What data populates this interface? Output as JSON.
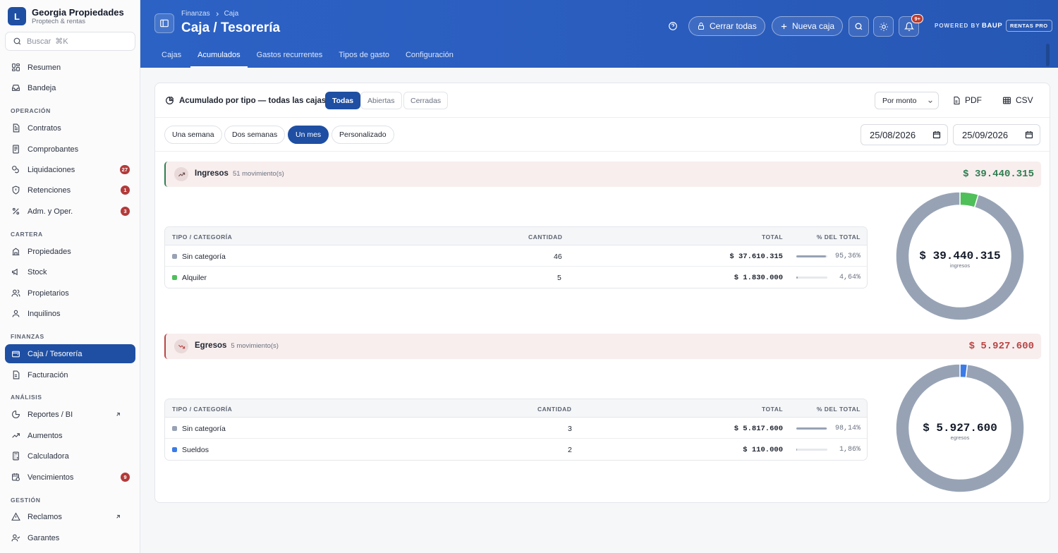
{
  "brand": {
    "initial": "L",
    "name": "Georgia Propiedades",
    "subtitle": "Proptech & rentas"
  },
  "search": {
    "placeholder": "Buscar",
    "shortcut": "⌘K"
  },
  "sidebar": {
    "top": [
      {
        "label": "Resumen",
        "icon": "grid-icon"
      },
      {
        "label": "Bandeja",
        "icon": "inbox-icon"
      }
    ],
    "sections": [
      {
        "label": "OPERACIÓN",
        "items": [
          {
            "label": "Contratos",
            "icon": "document-icon"
          },
          {
            "label": "Comprobantes",
            "icon": "receipt-icon"
          },
          {
            "label": "Liquidaciones",
            "icon": "coins-icon",
            "badge": "27"
          },
          {
            "label": "Retenciones",
            "icon": "shield-icon",
            "badge": "1"
          },
          {
            "label": "Adm. y Oper.",
            "icon": "percent-icon",
            "badge": "3"
          }
        ]
      },
      {
        "label": "CARTERA",
        "items": [
          {
            "label": "Propiedades",
            "icon": "building-icon"
          },
          {
            "label": "Stock",
            "icon": "megaphone-icon"
          },
          {
            "label": "Propietarios",
            "icon": "users-icon"
          },
          {
            "label": "Inquilinos",
            "icon": "user-icon"
          }
        ]
      },
      {
        "label": "FINANZAS",
        "items": [
          {
            "label": "Caja / Tesorería",
            "icon": "wallet-icon",
            "active": true
          },
          {
            "label": "Facturación",
            "icon": "invoice-icon"
          }
        ]
      },
      {
        "label": "ANÁLISIS",
        "items": [
          {
            "label": "Reportes / BI",
            "icon": "pie-chart-icon",
            "external": true
          },
          {
            "label": "Aumentos",
            "icon": "trend-up-icon"
          },
          {
            "label": "Calculadora",
            "icon": "calculator-icon"
          },
          {
            "label": "Vencimientos",
            "icon": "calendar-clock-icon",
            "badge": "9"
          }
        ]
      },
      {
        "label": "GESTIÓN",
        "items": [
          {
            "label": "Reclamos",
            "icon": "warning-icon",
            "external": true
          },
          {
            "label": "Garantes",
            "icon": "user-check-icon"
          }
        ]
      }
    ]
  },
  "header": {
    "breadcrumb": [
      "Finanzas",
      "Caja"
    ],
    "title": "Caja / Tesorería",
    "close_all": "Cerrar todas",
    "new_box": "Nueva caja",
    "notif_badge": "9+",
    "powered_by": "POWERED BY",
    "baup": "BAUP",
    "rentas": "RENTAS PRO",
    "tabs": [
      "Cajas",
      "Acumulados",
      "Gastos recurrentes",
      "Tipos de gasto",
      "Configuración"
    ],
    "active_tab": "Acumulados"
  },
  "panel": {
    "title": "Acumulado por tipo — todas las cajas",
    "filters": [
      "Todas",
      "Abiertas",
      "Cerradas"
    ],
    "active_filter": "Todas",
    "sort": "Por monto",
    "pdf": "PDF",
    "csv": "CSV",
    "ranges": [
      "Una semana",
      "Dos semanas",
      "Un mes",
      "Personalizado"
    ],
    "active_range": "Un mes",
    "date_from": "25/08/2026",
    "date_to": "25/09/2026"
  },
  "columns": {
    "type": "TIPO / CATEGORÍA",
    "qty": "CANTIDAD",
    "total": "TOTAL",
    "pct": "% DEL TOTAL"
  },
  "colors": {
    "positive": "#2e7d4f",
    "negative": "#b94545",
    "gray": "#97a3b5",
    "green": "#4fbf5a",
    "blue": "#3b7be8",
    "accent": "#1f4fa3"
  },
  "groups": [
    {
      "name": "Ingresos",
      "count": "51 movimiento(s)",
      "total": "$ 39.440.315",
      "donut_value": "$ 39.440.315",
      "donut_label": "ingresos",
      "sign": "positive",
      "rows": [
        {
          "label": "Sin categoría",
          "qty": "46",
          "total": "$ 37.610.315",
          "pct": "95,36%",
          "share": 0.9536,
          "color": "#97a3b5"
        },
        {
          "label": "Alquiler",
          "qty": "5",
          "total": "$ 1.830.000",
          "pct": "4,64%",
          "share": 0.0464,
          "color": "#4fbf5a"
        }
      ]
    },
    {
      "name": "Egresos",
      "count": "5 movimiento(s)",
      "total": "$ 5.927.600",
      "donut_value": "$ 5.927.600",
      "donut_label": "egresos",
      "sign": "negative",
      "rows": [
        {
          "label": "Sin categoría",
          "qty": "3",
          "total": "$ 5.817.600",
          "pct": "98,14%",
          "share": 0.9814,
          "color": "#97a3b5"
        },
        {
          "label": "Sueldos",
          "qty": "2",
          "total": "$ 110.000",
          "pct": "1,86%",
          "share": 0.0186,
          "color": "#3b7be8"
        }
      ]
    }
  ]
}
